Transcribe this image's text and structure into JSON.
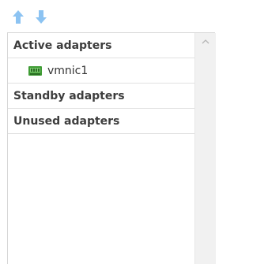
{
  "toolbar": {
    "move_up": {
      "icon": "arrow-up-icon",
      "color": "#8cc3f2"
    },
    "move_down": {
      "icon": "arrow-down-icon",
      "color": "#8cc3f2"
    }
  },
  "adapter_groups": [
    {
      "label": "Active adapters",
      "items": [
        {
          "name": "vmnic1",
          "icon": "network-card-icon",
          "icon_color": "#3f9c35"
        }
      ]
    },
    {
      "label": "Standby adapters",
      "items": []
    },
    {
      "label": "Unused adapters",
      "items": []
    }
  ],
  "scrollbar": {
    "up_icon": "chevron-up-icon"
  }
}
